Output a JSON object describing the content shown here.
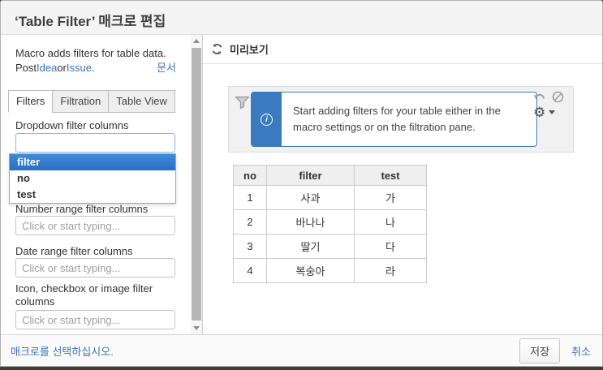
{
  "colors": {
    "accent_link_blue": "#3b73af",
    "dropdown_highlight_blue": "#2f79cc",
    "info_panel_blue": "#3a7bbf",
    "focused_input_border": "#85b7e3"
  },
  "dialog": {
    "title": "‘Table Filter’ 매크로 편집"
  },
  "sidebar": {
    "intro_line1": "Macro adds filters for table data.",
    "intro_post": "Post ",
    "intro_idea_link": "Idea",
    "intro_or": " or ",
    "intro_issue_link": "Issue",
    "intro_period": ".",
    "doc_link": "문서",
    "tabs": [
      {
        "label": "Filters"
      },
      {
        "label": "Filtration"
      },
      {
        "label": "Table View"
      }
    ],
    "fields": {
      "dropdown_label": "Dropdown filter columns",
      "dropdown_value": "",
      "dropdown_options": [
        "filter",
        "no",
        "test"
      ],
      "number_label": "Number range filter columns",
      "date_label": "Date range filter columns",
      "icon_label": "Icon, checkbox or image filter columns",
      "placeholder": "Click or start typing..."
    }
  },
  "preview": {
    "header": "미리보기",
    "info_text": "Start adding filters for your table either in the macro settings or on the filtration pane.",
    "table": {
      "headers": [
        "no",
        "filter",
        "test"
      ],
      "rows": [
        [
          "1",
          "사과",
          "가"
        ],
        [
          "2",
          "바나나",
          "나"
        ],
        [
          "3",
          "딸기",
          "다"
        ],
        [
          "4",
          "복숭아",
          "라"
        ]
      ]
    }
  },
  "footer": {
    "status_link": "매크로를 선택하십시오.",
    "save_label": "저장",
    "cancel_label": "취소"
  }
}
